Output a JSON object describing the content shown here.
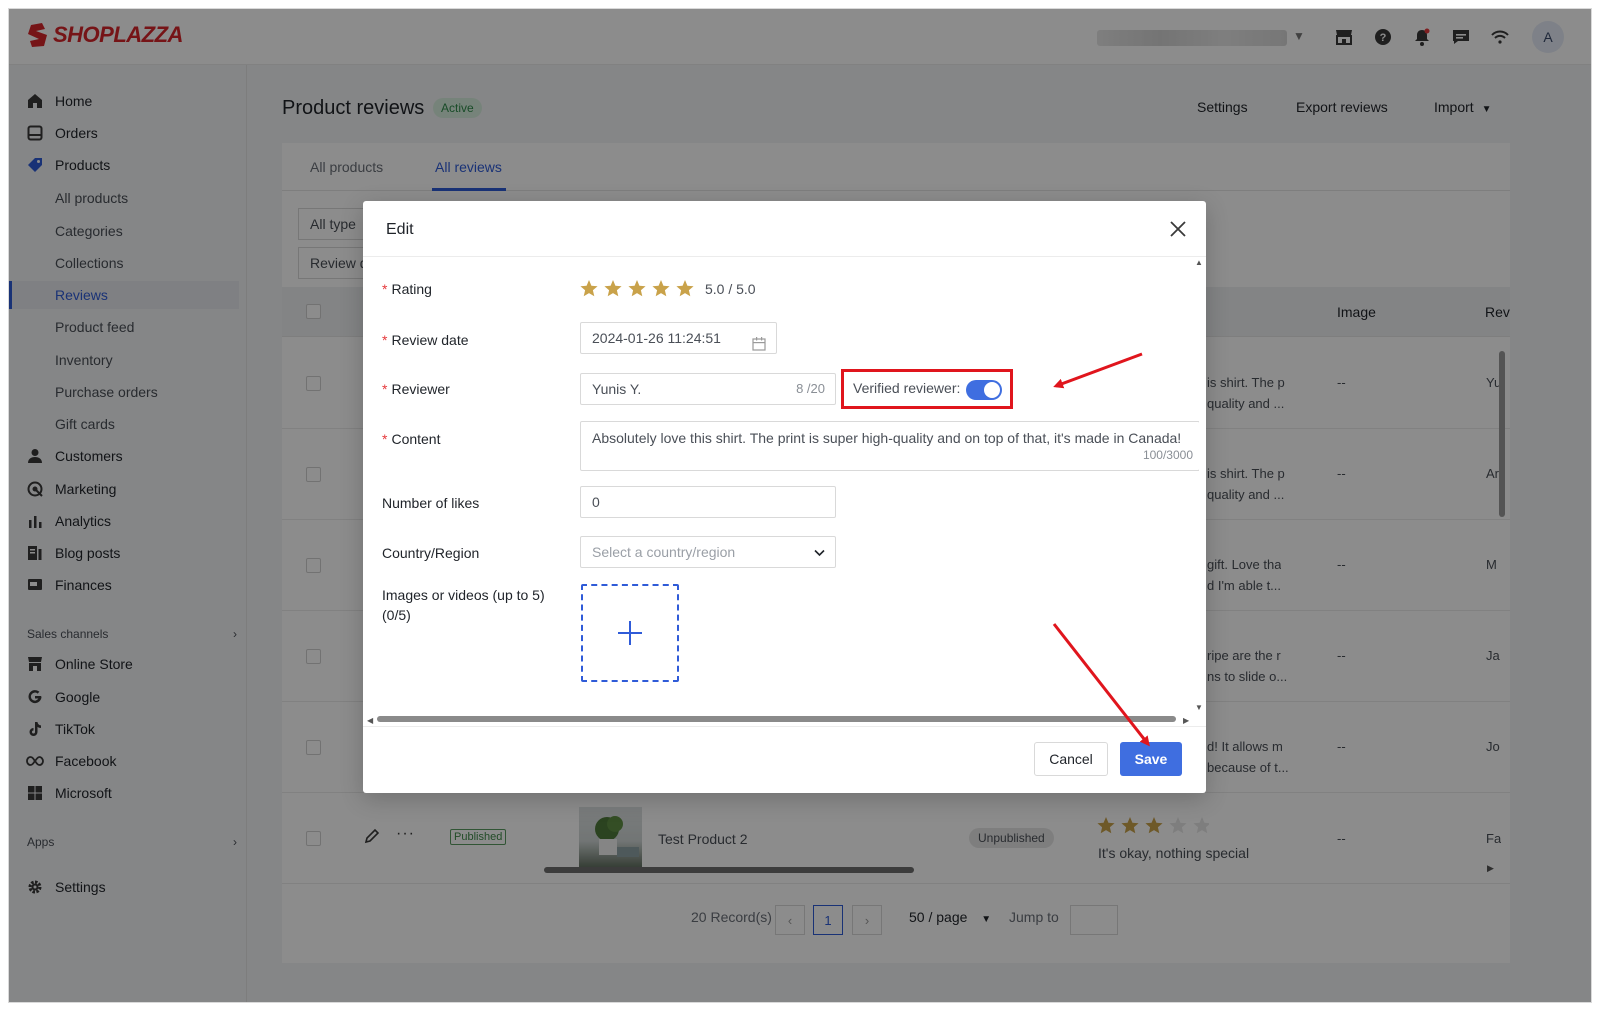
{
  "brand": {
    "name": "SHOPLAZZA",
    "color": "#d7262b"
  },
  "topbar": {
    "avatar_initial": "A"
  },
  "sidebar": {
    "items": [
      {
        "label": "Home",
        "icon": "home-icon"
      },
      {
        "label": "Orders",
        "icon": "orders-icon"
      },
      {
        "label": "Products",
        "icon": "tag-icon"
      }
    ],
    "product_subitems": [
      "All products",
      "Categories",
      "Collections",
      "Reviews",
      "Product feed",
      "Inventory",
      "Purchase orders",
      "Gift cards"
    ],
    "more_items": [
      {
        "label": "Customers",
        "icon": "person-icon"
      },
      {
        "label": "Marketing",
        "icon": "marketing-icon"
      },
      {
        "label": "Analytics",
        "icon": "analytics-icon"
      },
      {
        "label": "Blog posts",
        "icon": "blog-icon"
      },
      {
        "label": "Finances",
        "icon": "finances-icon"
      }
    ],
    "sales_channels_label": "Sales channels",
    "channels": [
      "Online Store",
      "Google",
      "TikTok",
      "Facebook",
      "Microsoft"
    ],
    "apps_label": "Apps",
    "settings_label": "Settings"
  },
  "page": {
    "title": "Product reviews",
    "status_badge": "Active",
    "actions": {
      "settings": "Settings",
      "export": "Export reviews",
      "import": "Import"
    },
    "tabs": [
      "All products",
      "All reviews"
    ],
    "filters": {
      "type": "All type",
      "review_date": "Review d"
    }
  },
  "table": {
    "headers": {
      "image": "Image",
      "review": "Rev"
    },
    "rows": [
      {
        "content_line1": "is shirt. The p",
        "content_line2": "quality and ...",
        "image": "--",
        "reviewer": "Yu"
      },
      {
        "content_line1": "is shirt. The p",
        "content_line2": "quality and ...",
        "image": "--",
        "reviewer": "Ar"
      },
      {
        "content_line1": "gift. Love tha",
        "content_line2": "d I'm able t...",
        "image": "--",
        "reviewer": "M"
      },
      {
        "content_line1": "ripe are the r",
        "content_line2": "ns to slide o...",
        "image": "--",
        "reviewer": "Ja"
      },
      {
        "content_line1": "d! It allows m",
        "content_line2": "because of t...",
        "image": "--",
        "reviewer": "Jo"
      }
    ],
    "last_row": {
      "status": "Published",
      "product": "Test Product 2",
      "product_status": "Unpublished",
      "rating": 3,
      "content": "It's okay, nothing special",
      "image": "--",
      "reviewer": "Fa"
    }
  },
  "pagination": {
    "records": "20 Record(s)",
    "current_page": "1",
    "page_size": "50 / page",
    "jump_label": "Jump to"
  },
  "modal": {
    "title": "Edit",
    "rating_label": "Rating",
    "rating_value": 5,
    "rating_text": "5.0 / 5.0",
    "review_date_label": "Review date",
    "review_date_value": "2024-01-26 11:24:51",
    "reviewer_label": "Reviewer",
    "reviewer_value": "Yunis Y.",
    "reviewer_counter": "8 /20",
    "verified_label": "Verified reviewer:",
    "verified_on": true,
    "content_label": "Content",
    "content_value": "Absolutely love this shirt. The print is super high-quality and on top of that, it's made in Canada!",
    "content_counter": "100/3000",
    "likes_label": "Number of likes",
    "likes_value": "0",
    "country_label": "Country/Region",
    "country_placeholder": "Select a country/region",
    "media_label": "Images or videos (up to 5)",
    "media_count": "(0/5)",
    "cancel_label": "Cancel",
    "save_label": "Save"
  },
  "colors": {
    "accent": "#3f6ee0",
    "highlight": "#e0151d",
    "star": "#c9a24a"
  }
}
